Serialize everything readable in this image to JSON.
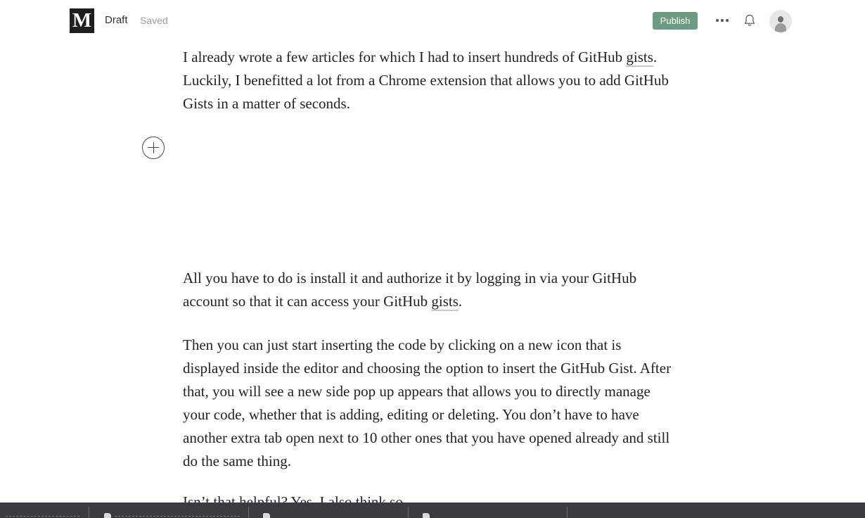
{
  "header": {
    "logo": "M",
    "status_draft": "Draft",
    "status_saved": "Saved",
    "publish_label": "Publish"
  },
  "article": {
    "paragraphs": [
      {
        "before": "I already wrote a few articles for which I had to insert hundreds of GitHub ",
        "link": "gists",
        "after": ". Luckily, I benefitted a lot from a Chrome extension that allows you to add GitHub Gists in a matter of seconds."
      },
      {
        "before": "All you have to do is install it and authorize it by logging in via your GitHub account so that it can access your GitHub ",
        "link": "gists",
        "after": "."
      },
      {
        "text": "Then you can just start inserting the code by clicking on a new icon that is displayed inside the editor and choosing the option to insert the GitHub Gist. After that, you will see a new side pop up appears that allows you to directly manage your code, whether that is adding, editing or deleting. You don’t have to have another extra tab open next to 10 other ones that you have opened already and still do the same thing."
      },
      {
        "text": "Isn’t that helpful? Yes, I also think so."
      }
    ]
  },
  "colors": {
    "publish_bg": "#6b9b81",
    "bottom_bar": "#3a3c3f"
  },
  "icons": [
    "medium-logo-icon",
    "more-dots-icon",
    "bell-icon",
    "avatar",
    "plus-circle-icon",
    "file-icon"
  ]
}
